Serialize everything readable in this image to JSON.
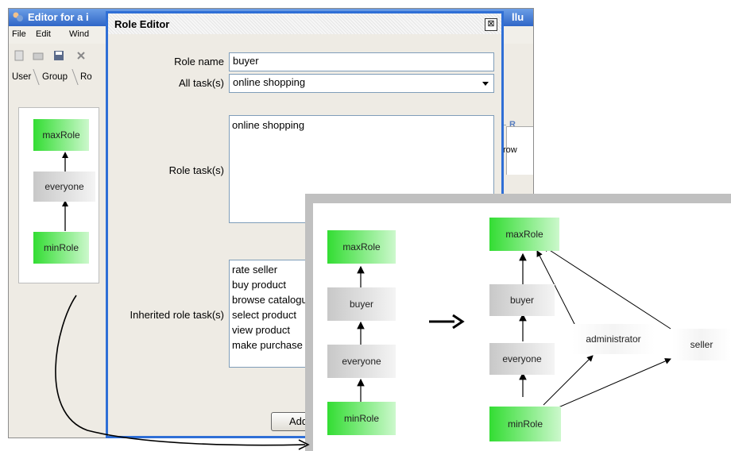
{
  "bg_window": {
    "title": "Editor for a i",
    "title_right": "llu",
    "menu": [
      "File",
      "Edit",
      "Wind"
    ],
    "tabs": [
      "User",
      "Group",
      "Ro"
    ],
    "table_header": "R",
    "table_cell": "row",
    "role_nodes": [
      "maxRole",
      "everyone",
      "minRole"
    ]
  },
  "dialog": {
    "title": "Role Editor",
    "close_glyph": "⊠",
    "role_name_label": "Role name",
    "role_name_value": "buyer",
    "all_tasks_label": "All task(s)",
    "all_tasks_value": "online shopping",
    "role_tasks_label": "Role task(s)",
    "role_tasks": [
      "online shopping"
    ],
    "inherited_label": "Inherited role task(s)",
    "inherited_tasks": [
      "rate seller",
      "buy product",
      "browse catalogu",
      "select product",
      "view product",
      "make purchase"
    ],
    "add_button": "Add"
  },
  "overlay": {
    "before_nodes": [
      "maxRole",
      "buyer",
      "everyone",
      "minRole"
    ],
    "after_nodes": [
      "maxRole",
      "buyer",
      "everyone",
      "minRole",
      "administrator",
      "seller"
    ],
    "arrow_glyph": "→"
  },
  "colors": {
    "role_green": "#33dd33",
    "role_grey": "#c8c8c8",
    "dialog_border": "#2f6fd6",
    "title_bar": "#2f66c7"
  }
}
